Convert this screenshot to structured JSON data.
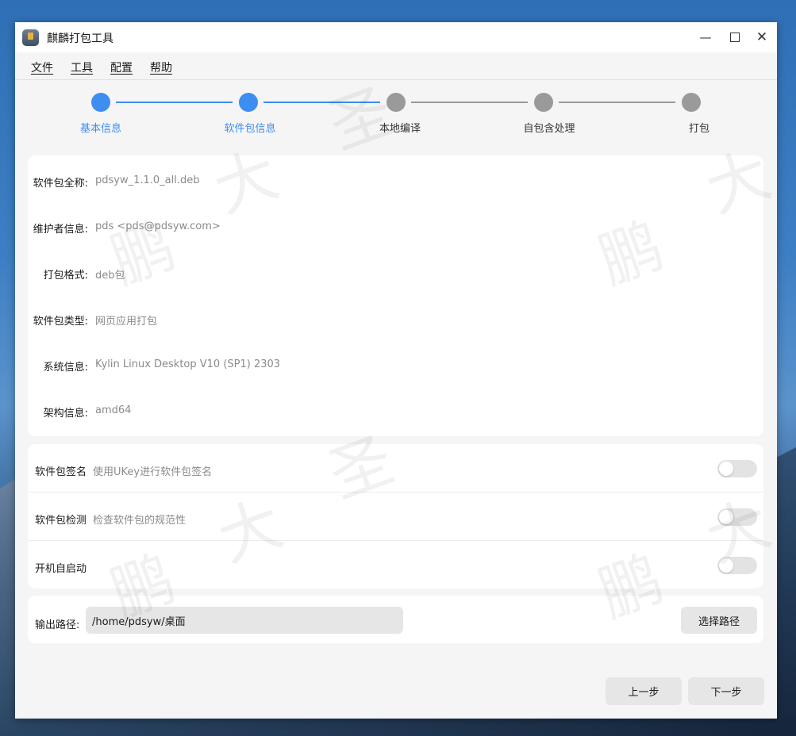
{
  "window": {
    "title": "麒麟打包工具"
  },
  "menu": [
    "文件",
    "工具",
    "配置",
    "帮助"
  ],
  "steps": [
    {
      "label": "基本信息",
      "active": true
    },
    {
      "label": "软件包信息",
      "active": true
    },
    {
      "label": "本地编译",
      "active": false
    },
    {
      "label": "自包含处理",
      "active": false
    },
    {
      "label": "打包",
      "active": false
    }
  ],
  "info": [
    {
      "label": "软件包全称:",
      "value": "pdsyw_1.1.0_all.deb"
    },
    {
      "label": "维护者信息:",
      "value": "pds <pds@pdsyw.com>"
    },
    {
      "label": "打包格式:",
      "value": "deb包"
    },
    {
      "label": "软件包类型:",
      "value": "网页应用打包"
    },
    {
      "label": "系统信息:",
      "value": "Kylin Linux Desktop V10 (SP1) 2303"
    },
    {
      "label": "架构信息:",
      "value": "amd64"
    }
  ],
  "options": [
    {
      "title": "软件包签名",
      "desc": "使用UKey进行软件包签名",
      "on": false
    },
    {
      "title": "软件包检测",
      "desc": "检查软件包的规范性",
      "on": false
    },
    {
      "title": "开机自启动",
      "desc": "",
      "on": false
    }
  ],
  "output": {
    "label": "输出路径:",
    "path": "/home/pdsyw/桌面",
    "choose_label": "选择路径"
  },
  "footer": {
    "prev_label": "上一步",
    "next_label": "下一步"
  },
  "watermark": [
    "鹏",
    "大",
    "圣"
  ],
  "colors": {
    "accent": "#3d8ef0",
    "inactive": "#9a9a9a"
  }
}
